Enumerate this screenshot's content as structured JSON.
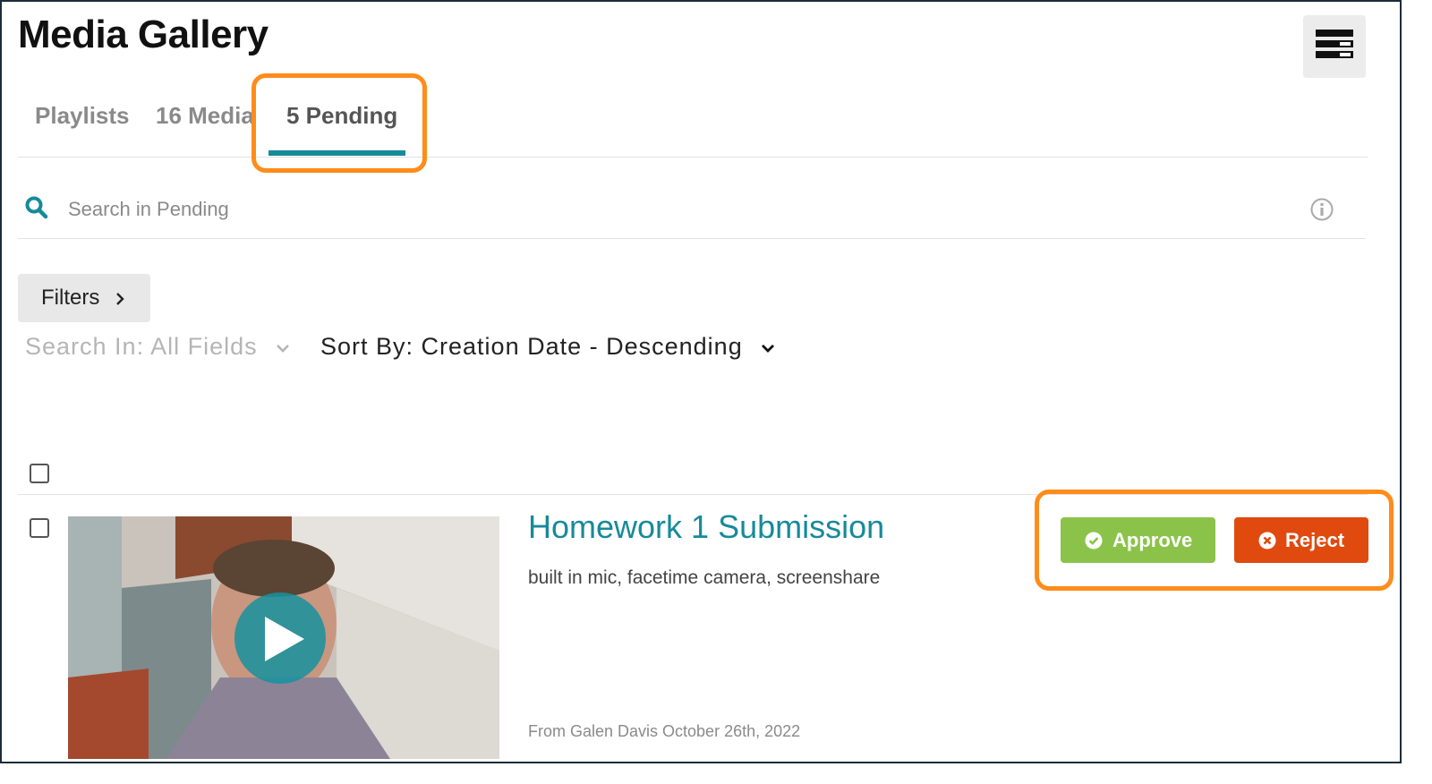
{
  "page": {
    "title": "Media Gallery"
  },
  "tabs": [
    {
      "label": "Playlists",
      "active": false
    },
    {
      "label": "16 Media",
      "active": false
    },
    {
      "label": "5 Pending",
      "active": true
    }
  ],
  "search": {
    "placeholder": "Search in Pending",
    "value": ""
  },
  "filters": {
    "label": "Filters"
  },
  "dropdowns": {
    "search_in": "Search In: All Fields",
    "sort_by": "Sort By: Creation Date - Descending"
  },
  "entries": [
    {
      "title": "Homework 1 Submission",
      "description": "built in mic, facetime camera, screenshare",
      "meta": "From Galen Davis October 26th, 2022",
      "actions": {
        "approve": "Approve",
        "reject": "Reject"
      }
    }
  ],
  "icons": {
    "menu": "menu-icon",
    "search": "search-icon",
    "info": "info-icon",
    "play": "play-icon",
    "approve": "check-circle-icon",
    "reject": "x-circle-icon"
  },
  "colors": {
    "accent": "#178a9a",
    "approve": "#8bc34a",
    "reject": "#e04a0f",
    "highlight": "#ff8c1a"
  }
}
